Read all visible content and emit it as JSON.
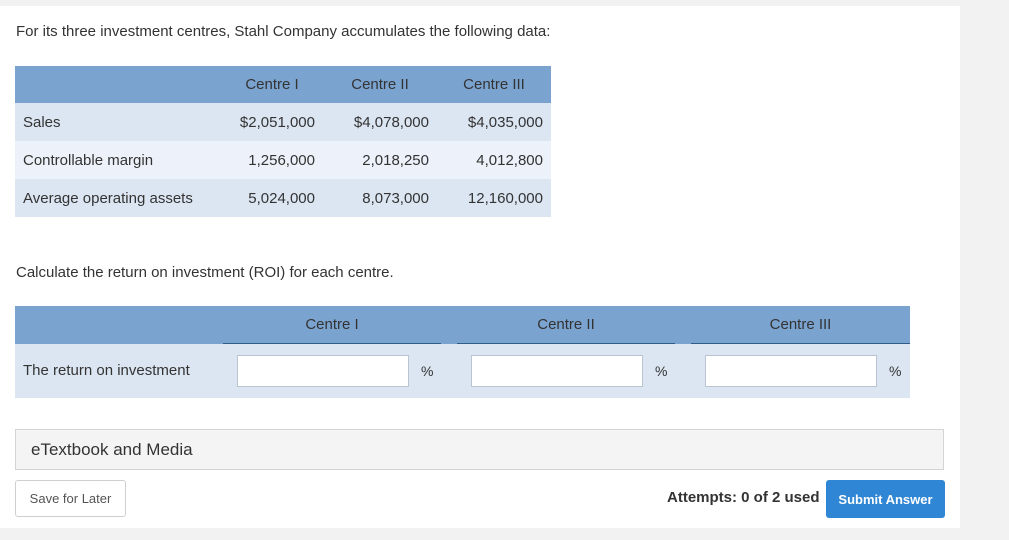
{
  "intro": "For its three investment centres, Stahl Company accumulates the following data:",
  "data_table": {
    "headers": [
      "Centre I",
      "Centre II",
      "Centre III"
    ],
    "rows": [
      {
        "label": "Sales",
        "values": [
          "$2,051,000",
          "$4,078,000",
          "$4,035,000"
        ]
      },
      {
        "label": "Controllable margin",
        "values": [
          "1,256,000",
          "2,018,250",
          "4,012,800"
        ]
      },
      {
        "label": "Average operating assets",
        "values": [
          "5,024,000",
          "8,073,000",
          "12,160,000"
        ]
      }
    ]
  },
  "instruction": "Calculate the return on investment (ROI) for each centre.",
  "answer_table": {
    "headers": [
      "Centre I",
      "Centre II",
      "Centre III"
    ],
    "row_label": "The return on investment",
    "inputs": [
      {
        "value": "",
        "unit": "%"
      },
      {
        "value": "",
        "unit": "%"
      },
      {
        "value": "",
        "unit": "%"
      }
    ]
  },
  "etextbook_label": "eTextbook and Media",
  "save_label": "Save for Later",
  "attempts_text": "Attempts: 0 of 2 used",
  "submit_label": "Submit Answer"
}
